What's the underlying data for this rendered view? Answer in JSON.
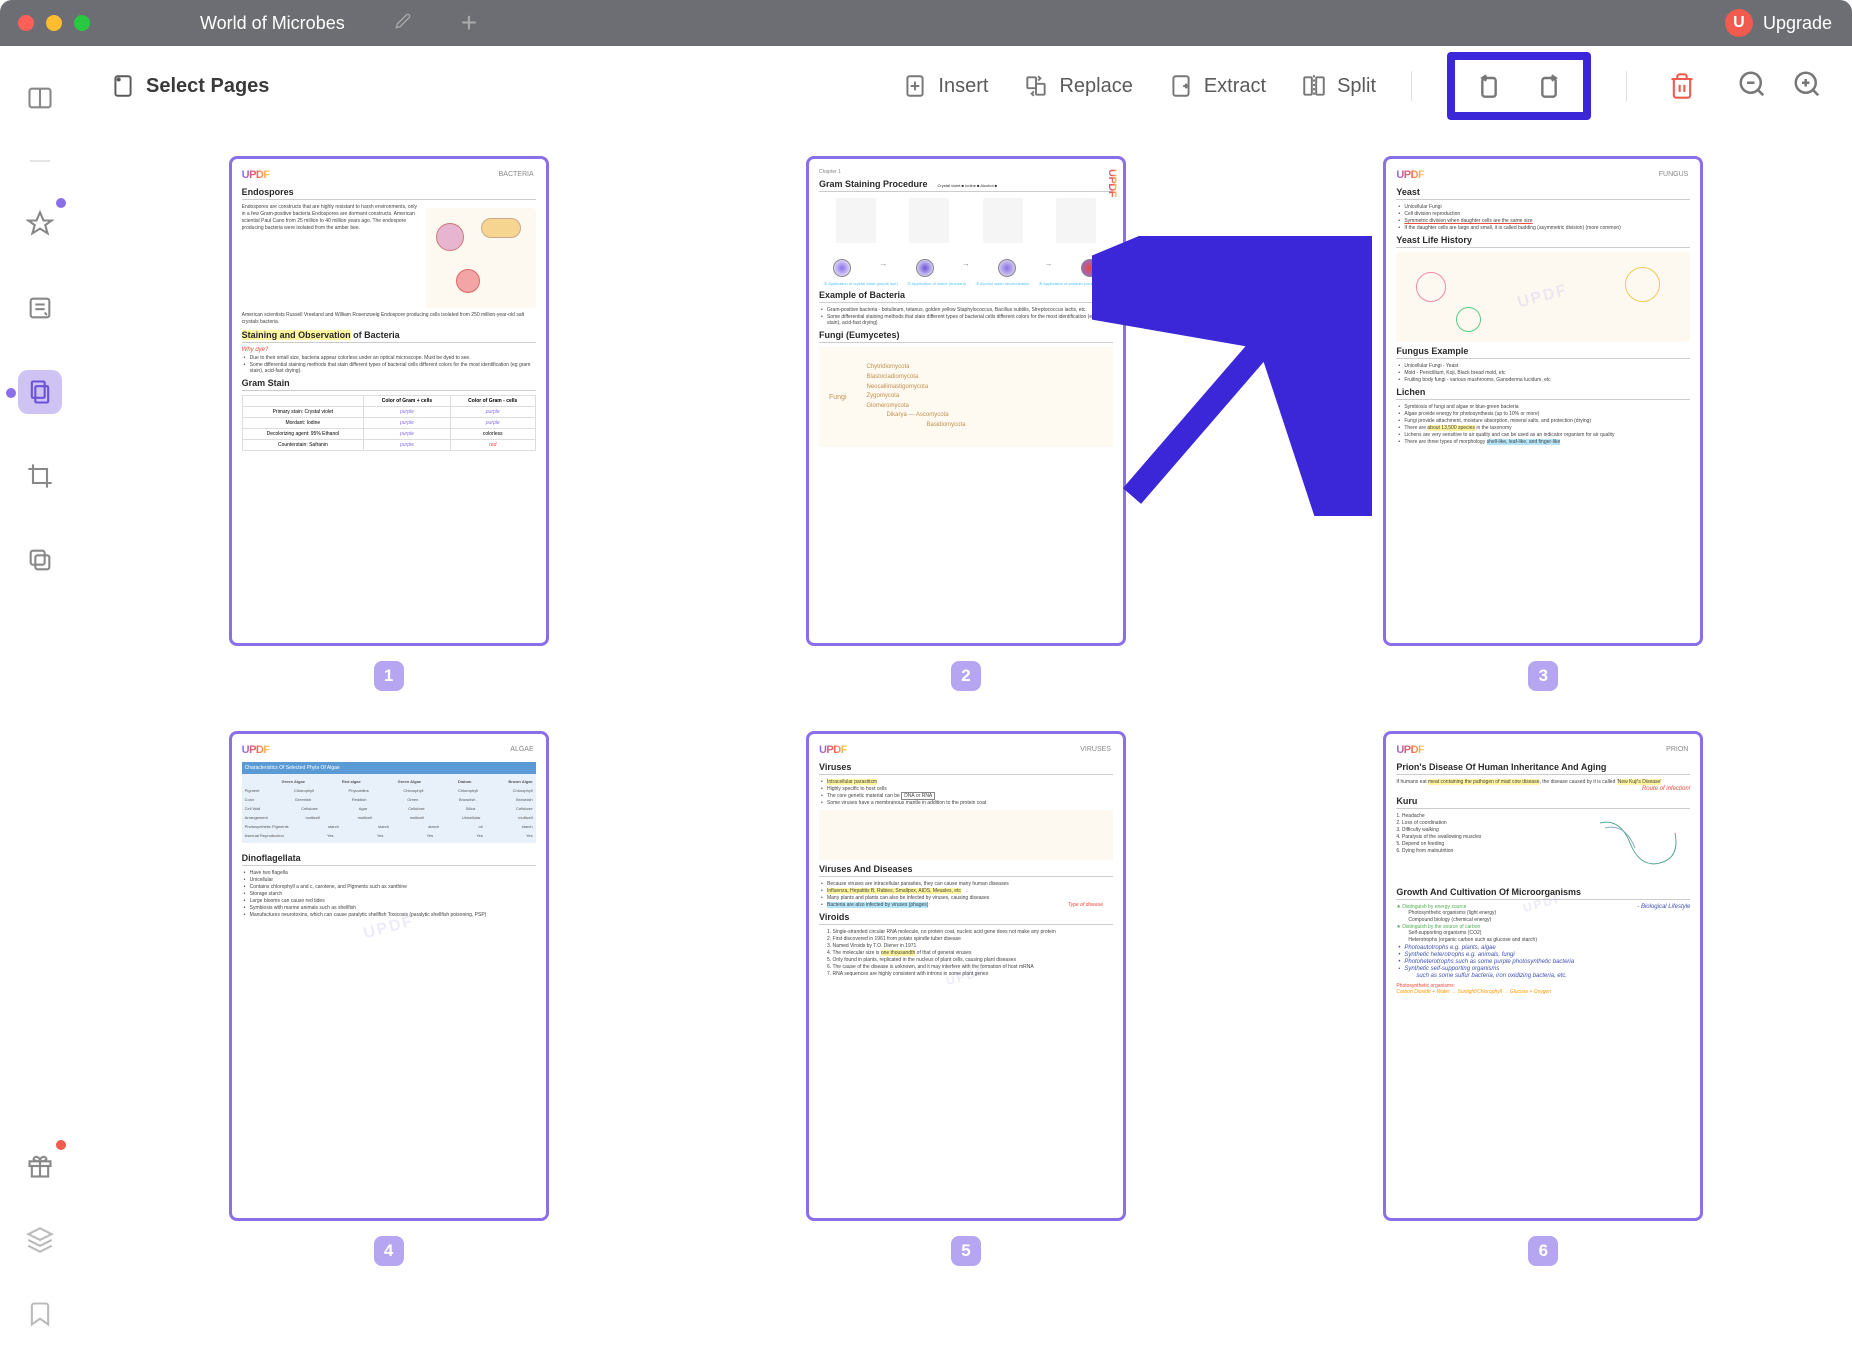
{
  "window": {
    "title": "World of Microbes",
    "upgrade_label": "Upgrade",
    "upgrade_initial": "U"
  },
  "toolbar": {
    "select_pages": "Select Pages",
    "insert": "Insert",
    "replace": "Replace",
    "extract": "Extract",
    "split": "Split"
  },
  "pages": {
    "logo_text": "UPDF",
    "page1": {
      "number": "1",
      "type": "BACTERIA",
      "h1": "Endospores",
      "p1": "Endospores are constructs that are highly resistant to harsh environments, only in a few Gram-positive bacteria Endospores are dormant constructs. American scientist Paul Cano from 25 million to 40 million years ago. The endospore producing bacteria were isolated from the amber bee.",
      "p2": "American scientists Russell Vreeland and William Rosenzweig Endospore producing cells isolated from 250 million-year-old salt crystals bacteria.",
      "h2_pre": "Staining and Observation",
      "h2_post": " of Bacteria",
      "why_dye": "Why dye?",
      "b1": "Due to their small size, bacteria appear colorless under an optical microscope. Must be dyed to see.",
      "b2": "Some differential staining methods that stain different types of bacterial cells different colors for the most identification (eg gram stain), acid-fast drying).",
      "h3": "Gram Stain",
      "table": {
        "col1": "Color of Gram + cells",
        "col2": "Color of Gram - cells",
        "row1_label": "Primary stain: Crystal violet",
        "row1_v1": "purple",
        "row1_v2": "purple",
        "row2_label": "Mordant: Iodine",
        "row2_v1": "purple",
        "row2_v2": "purple",
        "row3_label": "Decolorizing agent: 95% Ethanol",
        "row3_v1": "purple",
        "row3_v2": "colorless",
        "row4_label": "Counterstain: Safranin",
        "row4_v1": "purple",
        "row4_v2": "red"
      }
    },
    "page2": {
      "number": "2",
      "chapter": "Chapter 1",
      "h1": "Gram Staining Procedure",
      "legend": "Crystal violet ■ Iodine ■ Alcohol ■",
      "h2": "Example of Bacteria",
      "b1": "Gram-positive bacteria - botulinum, tetanus, golden yellow Staphylococcus, Bacillus subtilis, Streptococcus lactis, etc.",
      "b2": "Some differential staining methods that stain different types of bacterial cells different colors for the most identification (eg gram stain), acid-fast drying)",
      "h3": "Fungi (Eumycetes)",
      "fungi_branches": [
        "Chytridiomycota",
        "Blastocladiomycota",
        "Neocallimastigomycota",
        "Zygomycota",
        "Glomeromycota",
        "Ascomycota",
        "Basidiomycota"
      ],
      "fungi_root": "Fungi",
      "fungi_sub": "Dikarya"
    },
    "page3": {
      "number": "3",
      "type": "FUNGUS",
      "h1": "Yeast",
      "b1": "Unicellular Fungi",
      "b2": "Cell division reproduction",
      "b3": "Symmetric division when daughter cells are the same size",
      "b4": "If the daughter cells are large and small, it is called budding (asymmetric division) (more common)",
      "h2": "Yeast Life History",
      "h3": "Fungus Example",
      "b5": "Unicellular Fungi - Yeast",
      "b6": "Mold - Penicillium, Koji, Black bread mold, etc",
      "b7": "Fruiting body fungi - various mushrooms, Ganoderma lucidum, etc",
      "h4": "Lichen",
      "b8": "Symbiosis of fungi and algae or blue-green bacteria",
      "b9": "Algae provide energy for photosynthesis (up to 10% or more)",
      "b10": "Fungi provide attachment, moisture absorption, mineral salts, and protection (drying)",
      "b11_pre": "There are ",
      "b11_hl": "about 13,500 species",
      "b11_post": " in the taxonomy",
      "b12": "Lichens are very sensitive to air quality and can be used as an indicator organism for air quality",
      "b13_pre": "There are three types of morphology ",
      "b13_hl": "shell-like, leaf-like, and finger-like"
    },
    "page4": {
      "number": "4",
      "type": "ALGAE",
      "h1": "Characteristics Of Selected Phyla Of Algae",
      "table_headers": [
        "",
        "Green Algae",
        "Red algae",
        "Green Algae",
        "Diatom",
        "Brown Algae"
      ],
      "h2": "Dinoflagellata",
      "b1": "Have two flagella",
      "b2": "Unicellular",
      "b3": "Contains chlorophyll a and c, carotene, and Pigments such as xanthine",
      "b4": "Storage starch",
      "b5": "Large blooms can cause red tides",
      "b6": "Symbiosis with marine animals such as shellfish",
      "b7": "Manufactures neurotoxins, which can cause paralytic shellfish Toxicosis (paralytic shellfish poisoning, PSP)"
    },
    "page5": {
      "number": "5",
      "type": "VIRUSES",
      "h1": "Viruses",
      "b1": "Intracellular parasitism",
      "b2": "Highly specific to host cells",
      "b3_pre": "The core genetic material can be ",
      "b3_box": "DNA or RNA",
      "b4": "Some viruses have a membranous mantle in addition to the protein coat",
      "h2": "Viruses And Diseases",
      "b5": "Because viruses are intracellular parasites, they can cause many human diseases",
      "b6": "Influenza, Hepatitis B, Rabies, Smallpox, AIDS, Measles, etc",
      "b7": "Many plants and plants can also be infected by viruses, causing diseases",
      "b8": "Bacteria are also infected by viruses (phages)",
      "note": "Type of disease",
      "h3": "Viroids",
      "v1": "Single-stranded circular RNA molecule, no protein coat, nucleic acid gene does not make any protein",
      "v2": "First discovered in 1961 from potato spindle tuber disease",
      "v3": "Named Viroids by T.O. Diener in 1971",
      "v4_pre": "The molecular size is ",
      "v4_hl": "one thousandth",
      "v4_post": " of that of general viruses",
      "v5": "Only found in plants, replicated in the nucleus of plant cells, causing plant diseases",
      "v6": "The cause of the disease is unknown, and it may interfere with the formation of host mRNA",
      "v7": "RNA sequences are highly consistent with introns in some plant genes"
    },
    "page6": {
      "number": "6",
      "type": "PRION",
      "h1": "Prion's Disease Of Human Inheritance And Aging",
      "p1_pre": "If humans eat ",
      "p1_hl1": "meat containing the pathogen of mad cow disease",
      "p1_mid": ", the disease caused by it is called ",
      "p1_hl2": "'New Kuji's Disease'",
      "route": "Route of infection!",
      "h2": "Kuru",
      "k1": "Headache",
      "k2": "Loss of coordination",
      "k3": "Difficulty walking",
      "k4": "Paralysis of the swallowing muscles",
      "k5": "Depend on feeding",
      "k6": "Dying from malnutrition",
      "h3": "Growth And Cultivation Of Microorganisms",
      "g1": "Distinguish by energy source",
      "g1_note": "- Biological Lifestyle",
      "g1a": "Photosynthetic organisms (light energy)",
      "g1b": "Compound biology (chemical energy)",
      "g2": "Distinguish by the source of carbon",
      "g2a": "Self-supporting organisms (CO2)",
      "g2b": "Heterotrophs (organic carbon such as glucose and starch)",
      "g3": "Photoautotrophs e.g. plants, algae",
      "g4": "Synthetic heterotrophs e.g. animals, fungi",
      "g5": "Photoheterotrophs such as some purple photosynthetic bacteria",
      "g6": "Synthetic self-supporting organisms",
      "g6_note": "such as some sulfur bacteria, iron oxidizing bacteria, etc.",
      "ps": "Photosynthetic organisms:",
      "ps_eq": "Carbon Dioxide + Water → Sunlight/Chlorophyll → Glucose + Oxygen"
    }
  }
}
